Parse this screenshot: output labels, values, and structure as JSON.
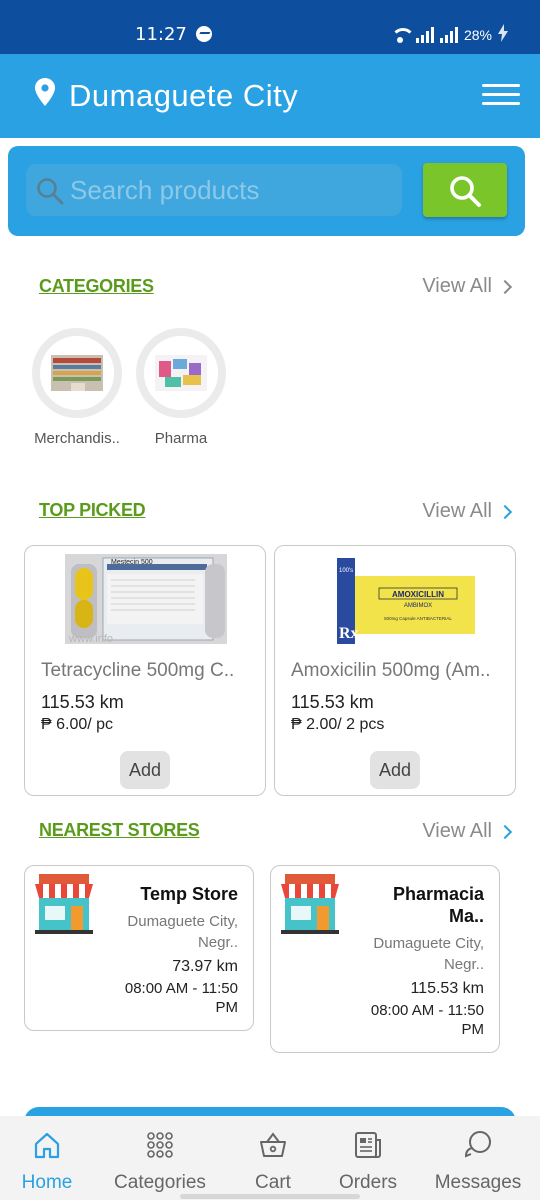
{
  "status": {
    "time": "11:27",
    "battery": "28%"
  },
  "header": {
    "location": "Dumaguete City"
  },
  "search": {
    "placeholder": "Search  products"
  },
  "categories": {
    "title": "CATEGORIES",
    "view_all": "View All",
    "items": [
      {
        "label": "Merchandis.."
      },
      {
        "label": "Pharma"
      }
    ]
  },
  "top_picked": {
    "title": "TOP PICKED",
    "view_all": "View All",
    "items": [
      {
        "name": "Tetracycline 500mg C..",
        "distance": "115.53 km",
        "price": "₱ 6.00/ pc",
        "add_label": "Add",
        "pack_text": "Mestecin 500",
        "watermark": "www.info"
      },
      {
        "name": "Amoxicilin 500mg (Am..",
        "distance": "115.53 km",
        "price": "₱ 2.00/ 2 pcs",
        "add_label": "Add",
        "pack_top": "100's",
        "pack_brand": "AMOXICILLIN",
        "pack_sub": "AMBIMOX",
        "pack_desc": "500mg Capsule\nANTIBACTERIAL",
        "pack_rx": "Rx"
      }
    ]
  },
  "nearest_stores": {
    "title": "NEAREST STORES",
    "view_all": "View All",
    "items": [
      {
        "name": "Temp Store",
        "address_1": "Dumaguete City,",
        "address_2": "Negr..",
        "distance": "73.97 km",
        "hours_1": "08:00 AM - 11:50",
        "hours_2": "PM"
      },
      {
        "name_1": "Pharmacia",
        "name_2": "Ma..",
        "address_1": "Dumaguete City,",
        "address_2": "Negr..",
        "distance": "115.53 km",
        "hours_1": "08:00 AM - 11:50",
        "hours_2": "PM"
      }
    ]
  },
  "nav": {
    "active": "home",
    "accent": "#2aa1e3",
    "items": [
      {
        "label": "Home"
      },
      {
        "label": "Categories"
      },
      {
        "label": "Cart"
      },
      {
        "label": "Orders"
      },
      {
        "label": "Messages"
      }
    ]
  },
  "colors": {
    "primary": "#2aa1e3",
    "status_bar": "#0d4f9e",
    "search_button": "#7ac62a",
    "section_title": "#5a9b1c"
  }
}
